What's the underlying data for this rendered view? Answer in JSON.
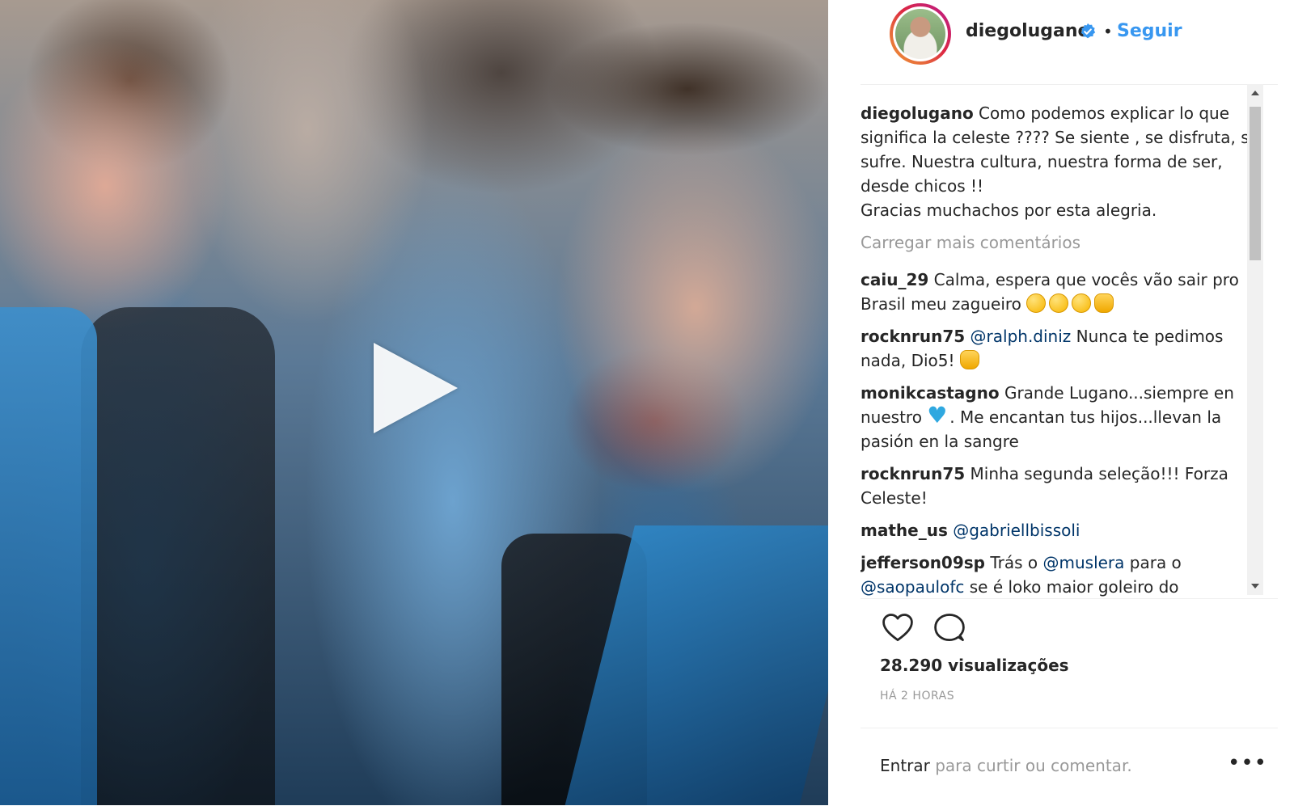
{
  "post": {
    "username": "diegolugano",
    "follow_label": "Seguir",
    "bullet": "•",
    "caption": {
      "author": "diegolugano",
      "line1": "Como podemos explicar lo que significa la celeste ???? Se siente , se disfruta, se sufre. Nuestra cultura, nuestra forma de ser, desde chicos !!",
      "line2": "Gracias muchachos por esta alegria."
    },
    "load_more": "Carregar mais comentários",
    "comments": [
      {
        "author": "caiu_29",
        "text": "Calma, espera que vocês vão sair pro Brasil meu zagueiro",
        "emojis": [
          "smile-emoji",
          "smile-emoji",
          "smile-emoji",
          "clap-emoji"
        ]
      },
      {
        "author": "rocknrun75",
        "mention": "@ralph.diniz",
        "text": "Nunca te pedimos nada, Dio5!",
        "emojis": [
          "fist-emoji"
        ]
      },
      {
        "author": "monikcastagno",
        "text_before": "Grande Lugano...siempre en nuestro",
        "text_after": ". Me encantan tus hijos...llevan la pasión en la sangre",
        "emojis": [
          "blue-heart-emoji"
        ]
      },
      {
        "author": "rocknrun75",
        "text": "Minha segunda seleção!!! Forza Celeste!"
      },
      {
        "author": "mathe_us",
        "mention": "@gabriellbissoli"
      },
      {
        "author": "jefferson09sp",
        "text_before": "Trás o",
        "mention1": "@muslera",
        "text_middle": "para o",
        "mention2": "@saopaulofc",
        "text_after": "se é loko maior goleiro do"
      }
    ],
    "views": "28.290 visualizações",
    "timestamp": "HÁ 2 HORAS",
    "login": {
      "link": "Entrar",
      "rest": "para curtir ou comentar."
    },
    "more_options": "•••"
  },
  "icons": {
    "play": "play-icon",
    "verified": "verified-badge-icon",
    "like": "heart-icon",
    "comment": "comment-bubble-icon",
    "more": "more-options-icon"
  },
  "colors": {
    "link_blue": "#3897f0",
    "mention_blue": "#003569",
    "verified_blue": "#3897f0",
    "muted_gray": "#999999",
    "text_dark": "#262626"
  }
}
